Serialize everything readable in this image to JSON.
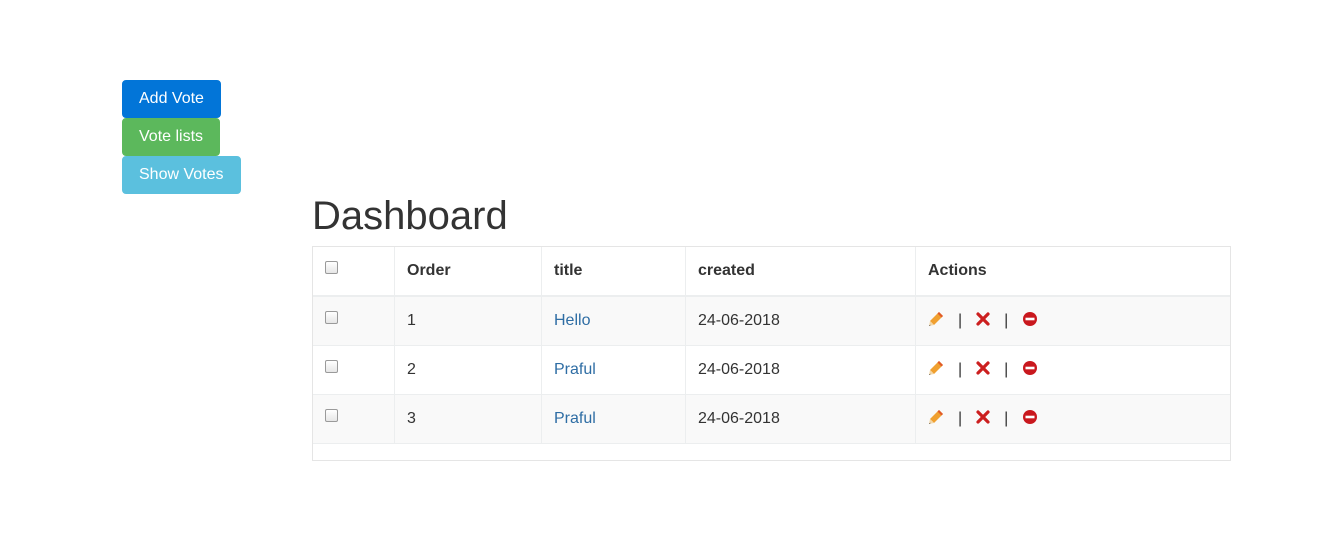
{
  "buttons": {
    "add_vote": "Add Vote",
    "vote_lists": "Vote lists",
    "show_votes": "Show Votes"
  },
  "page_title": "Dashboard",
  "table": {
    "headers": {
      "order": "Order",
      "title": "title",
      "created": "created",
      "actions": "Actions"
    },
    "rows": [
      {
        "order": "1",
        "title": "Hello",
        "created": "24-06-2018"
      },
      {
        "order": "2",
        "title": "Praful",
        "created": "24-06-2018"
      },
      {
        "order": "3",
        "title": "Praful",
        "created": "24-06-2018"
      }
    ],
    "action_separator": "|",
    "action_icons": [
      "pencil-icon",
      "delete-x-icon",
      "block-icon"
    ]
  },
  "colors": {
    "primary": "#0275d8",
    "success": "#5cb85c",
    "info": "#5bc0de",
    "link": "#2e6da4"
  }
}
